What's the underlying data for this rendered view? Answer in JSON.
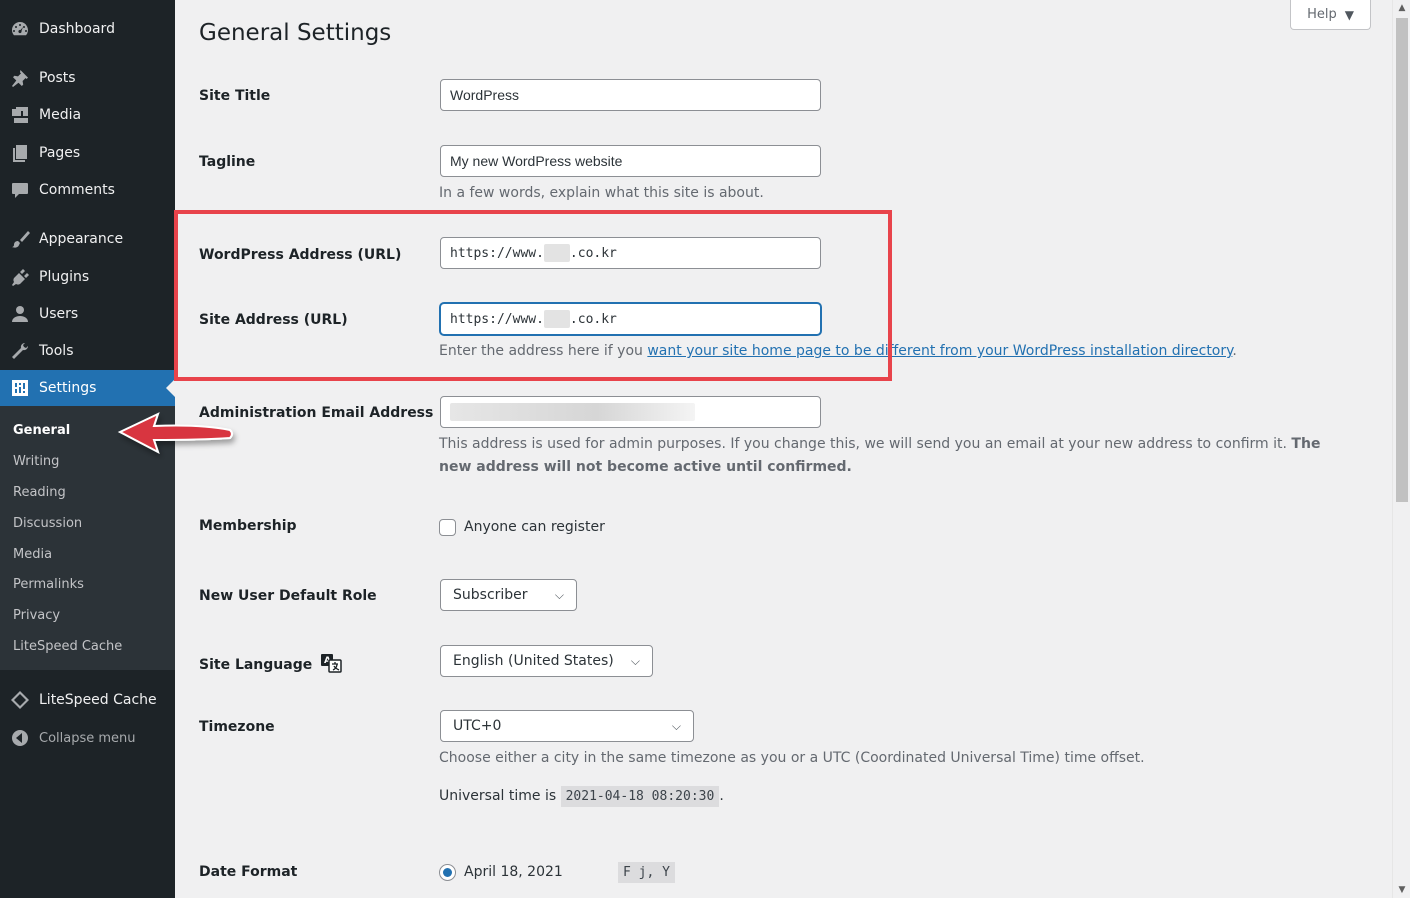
{
  "sidebar": {
    "items": [
      {
        "label": "Dashboard",
        "icon": "dashboard-icon"
      },
      {
        "label": "Posts",
        "icon": "pushpin-icon"
      },
      {
        "label": "Media",
        "icon": "media-icon"
      },
      {
        "label": "Pages",
        "icon": "pages-icon"
      },
      {
        "label": "Comments",
        "icon": "comment-icon"
      },
      {
        "label": "Appearance",
        "icon": "paintbrush-icon"
      },
      {
        "label": "Plugins",
        "icon": "plugin-icon"
      },
      {
        "label": "Users",
        "icon": "user-icon"
      },
      {
        "label": "Tools",
        "icon": "wrench-icon"
      },
      {
        "label": "Settings",
        "icon": "settings-icon"
      }
    ],
    "submenu": [
      "General",
      "Writing",
      "Reading",
      "Discussion",
      "Media",
      "Permalinks",
      "Privacy",
      "LiteSpeed Cache"
    ],
    "litespeed": "LiteSpeed Cache",
    "collapse": "Collapse menu"
  },
  "header": {
    "title": "General Settings",
    "help": "Help"
  },
  "form": {
    "site_title": {
      "label": "Site Title",
      "value": "WordPress"
    },
    "tagline": {
      "label": "Tagline",
      "value": "My new WordPress website",
      "desc": "In a few words, explain what this site is about."
    },
    "wp_address": {
      "label": "WordPress Address (URL)",
      "prefix": "https://www.",
      "suffix": ".co.kr"
    },
    "site_address": {
      "label": "Site Address (URL)",
      "prefix": "https://www.",
      "suffix": ".co.kr",
      "desc_pre": "Enter the address here if you ",
      "desc_link": "want your site home page to be different from your WordPress installation directory",
      "desc_post": "."
    },
    "admin_email": {
      "label": "Administration Email Address",
      "desc_pre": "This address is used for admin purposes. If you change this, we will send you an email at your new address to confirm it. ",
      "desc_bold": "The new address will not become active until confirmed."
    },
    "membership": {
      "label": "Membership",
      "checkbox": "Anyone can register"
    },
    "default_role": {
      "label": "New User Default Role",
      "value": "Subscriber"
    },
    "language": {
      "label": "Site Language",
      "value": "English (United States)"
    },
    "timezone": {
      "label": "Timezone",
      "value": "UTC+0",
      "desc": "Choose either a city in the same timezone as you or a UTC (Coordinated Universal Time) time offset.",
      "universal_pre": "Universal time is ",
      "universal_time": "2021-04-18 08:20:30",
      "universal_post": "."
    },
    "date_format": {
      "label": "Date Format",
      "option": "April 18, 2021",
      "code": "F j, Y"
    }
  },
  "colors": {
    "accent": "#2271b1",
    "highlight": "#e8434b",
    "sidebar": "#1d2327"
  }
}
